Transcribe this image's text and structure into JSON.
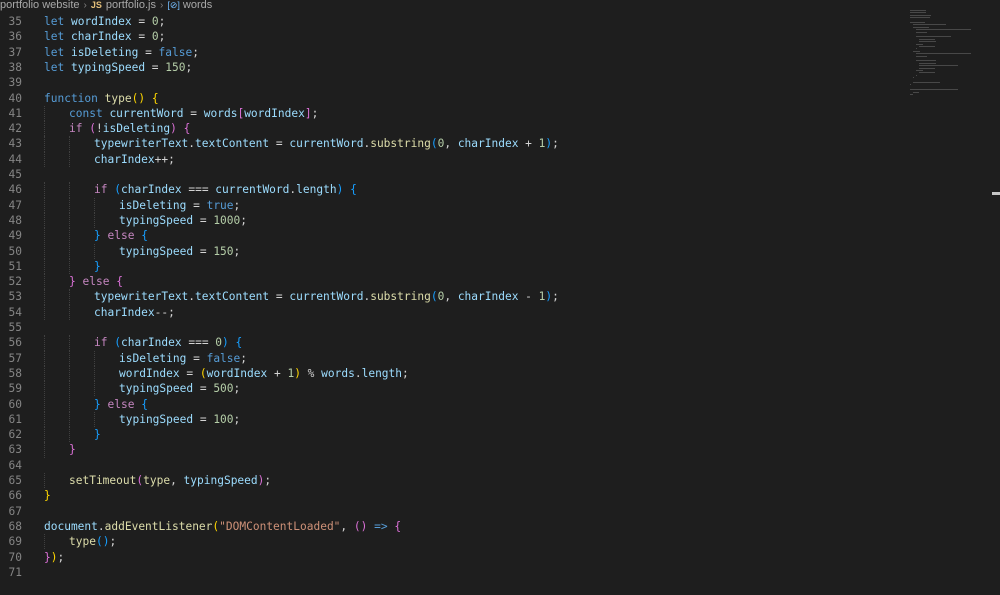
{
  "breadcrumb": {
    "folder": "portfolio website",
    "file_badge": "JS",
    "file": "portfolio.js",
    "symbol_badge": "[⊘]",
    "symbol": "words"
  },
  "colors": {
    "keyword": "#c586c0",
    "storage": "#569cd6",
    "variable": "#9cdcfe",
    "function": "#dcdcaa",
    "string": "#ce9178",
    "number": "#b5cea8",
    "plain": "#d4d4d4",
    "bracket1": "#ffd700",
    "bracket2": "#da70d6",
    "bracket3": "#179fff",
    "line_number": "#858585"
  },
  "lines": [
    {
      "n": "35",
      "indent": 0,
      "tokens": [
        [
          "storage",
          "let"
        ],
        [
          "plain",
          " "
        ],
        [
          "variable",
          "wordIndex"
        ],
        [
          "plain",
          " = "
        ],
        [
          "number",
          "0"
        ],
        [
          "plain",
          ";"
        ]
      ]
    },
    {
      "n": "36",
      "indent": 0,
      "tokens": [
        [
          "storage",
          "let"
        ],
        [
          "plain",
          " "
        ],
        [
          "variable",
          "charIndex"
        ],
        [
          "plain",
          " = "
        ],
        [
          "number",
          "0"
        ],
        [
          "plain",
          ";"
        ]
      ]
    },
    {
      "n": "37",
      "indent": 0,
      "tokens": [
        [
          "storage",
          "let"
        ],
        [
          "plain",
          " "
        ],
        [
          "variable",
          "isDeleting"
        ],
        [
          "plain",
          " = "
        ],
        [
          "storage",
          "false"
        ],
        [
          "plain",
          ";"
        ]
      ]
    },
    {
      "n": "38",
      "indent": 0,
      "tokens": [
        [
          "storage",
          "let"
        ],
        [
          "plain",
          " "
        ],
        [
          "variable",
          "typingSpeed"
        ],
        [
          "plain",
          " = "
        ],
        [
          "number",
          "150"
        ],
        [
          "plain",
          ";"
        ]
      ]
    },
    {
      "n": "39",
      "indent": 0,
      "tokens": []
    },
    {
      "n": "40",
      "indent": 0,
      "tokens": [
        [
          "storage",
          "function"
        ],
        [
          "plain",
          " "
        ],
        [
          "function",
          "type"
        ],
        [
          "bracket1",
          "()"
        ],
        [
          "plain",
          " "
        ],
        [
          "bracket1",
          "{"
        ]
      ]
    },
    {
      "n": "41",
      "indent": 1,
      "tokens": [
        [
          "storage",
          "const"
        ],
        [
          "plain",
          " "
        ],
        [
          "variable",
          "currentWord"
        ],
        [
          "plain",
          " = "
        ],
        [
          "variable",
          "words"
        ],
        [
          "bracket2",
          "["
        ],
        [
          "variable",
          "wordIndex"
        ],
        [
          "bracket2",
          "]"
        ],
        [
          "plain",
          ";"
        ]
      ]
    },
    {
      "n": "42",
      "indent": 1,
      "tokens": [
        [
          "keyword",
          "if"
        ],
        [
          "plain",
          " "
        ],
        [
          "bracket2",
          "("
        ],
        [
          "plain",
          "!"
        ],
        [
          "variable",
          "isDeleting"
        ],
        [
          "bracket2",
          ")"
        ],
        [
          "plain",
          " "
        ],
        [
          "bracket2",
          "{"
        ]
      ]
    },
    {
      "n": "43",
      "indent": 2,
      "tokens": [
        [
          "variable",
          "typewriterText"
        ],
        [
          "plain",
          "."
        ],
        [
          "variable",
          "textContent"
        ],
        [
          "plain",
          " = "
        ],
        [
          "variable",
          "currentWord"
        ],
        [
          "plain",
          "."
        ],
        [
          "function",
          "substring"
        ],
        [
          "bracket3",
          "("
        ],
        [
          "number",
          "0"
        ],
        [
          "plain",
          ", "
        ],
        [
          "variable",
          "charIndex"
        ],
        [
          "plain",
          " + "
        ],
        [
          "number",
          "1"
        ],
        [
          "bracket3",
          ")"
        ],
        [
          "plain",
          ";"
        ]
      ]
    },
    {
      "n": "44",
      "indent": 2,
      "tokens": [
        [
          "variable",
          "charIndex"
        ],
        [
          "plain",
          "++;"
        ]
      ]
    },
    {
      "n": "45",
      "indent": 0,
      "tokens": []
    },
    {
      "n": "46",
      "indent": 2,
      "tokens": [
        [
          "keyword",
          "if"
        ],
        [
          "plain",
          " "
        ],
        [
          "bracket3",
          "("
        ],
        [
          "variable",
          "charIndex"
        ],
        [
          "plain",
          " === "
        ],
        [
          "variable",
          "currentWord"
        ],
        [
          "plain",
          "."
        ],
        [
          "variable",
          "length"
        ],
        [
          "bracket3",
          ")"
        ],
        [
          "plain",
          " "
        ],
        [
          "bracket3",
          "{"
        ]
      ]
    },
    {
      "n": "47",
      "indent": 3,
      "tokens": [
        [
          "variable",
          "isDeleting"
        ],
        [
          "plain",
          " = "
        ],
        [
          "storage",
          "true"
        ],
        [
          "plain",
          ";"
        ]
      ]
    },
    {
      "n": "48",
      "indent": 3,
      "tokens": [
        [
          "variable",
          "typingSpeed"
        ],
        [
          "plain",
          " = "
        ],
        [
          "number",
          "1000"
        ],
        [
          "plain",
          ";"
        ]
      ]
    },
    {
      "n": "49",
      "indent": 2,
      "tokens": [
        [
          "bracket3",
          "}"
        ],
        [
          "plain",
          " "
        ],
        [
          "keyword",
          "else"
        ],
        [
          "plain",
          " "
        ],
        [
          "bracket3",
          "{"
        ]
      ]
    },
    {
      "n": "50",
      "indent": 3,
      "tokens": [
        [
          "variable",
          "typingSpeed"
        ],
        [
          "plain",
          " = "
        ],
        [
          "number",
          "150"
        ],
        [
          "plain",
          ";"
        ]
      ]
    },
    {
      "n": "51",
      "indent": 2,
      "tokens": [
        [
          "bracket3",
          "}"
        ]
      ]
    },
    {
      "n": "52",
      "indent": 1,
      "tokens": [
        [
          "bracket2",
          "}"
        ],
        [
          "plain",
          " "
        ],
        [
          "keyword",
          "else"
        ],
        [
          "plain",
          " "
        ],
        [
          "bracket2",
          "{"
        ]
      ]
    },
    {
      "n": "53",
      "indent": 2,
      "tokens": [
        [
          "variable",
          "typewriterText"
        ],
        [
          "plain",
          "."
        ],
        [
          "variable",
          "textContent"
        ],
        [
          "plain",
          " = "
        ],
        [
          "variable",
          "currentWord"
        ],
        [
          "plain",
          "."
        ],
        [
          "function",
          "substring"
        ],
        [
          "bracket3",
          "("
        ],
        [
          "number",
          "0"
        ],
        [
          "plain",
          ", "
        ],
        [
          "variable",
          "charIndex"
        ],
        [
          "plain",
          " - "
        ],
        [
          "number",
          "1"
        ],
        [
          "bracket3",
          ")"
        ],
        [
          "plain",
          ";"
        ]
      ]
    },
    {
      "n": "54",
      "indent": 2,
      "tokens": [
        [
          "variable",
          "charIndex"
        ],
        [
          "plain",
          "--;"
        ]
      ]
    },
    {
      "n": "55",
      "indent": 0,
      "tokens": []
    },
    {
      "n": "56",
      "indent": 2,
      "tokens": [
        [
          "keyword",
          "if"
        ],
        [
          "plain",
          " "
        ],
        [
          "bracket3",
          "("
        ],
        [
          "variable",
          "charIndex"
        ],
        [
          "plain",
          " === "
        ],
        [
          "number",
          "0"
        ],
        [
          "bracket3",
          ")"
        ],
        [
          "plain",
          " "
        ],
        [
          "bracket3",
          "{"
        ]
      ]
    },
    {
      "n": "57",
      "indent": 3,
      "tokens": [
        [
          "variable",
          "isDeleting"
        ],
        [
          "plain",
          " = "
        ],
        [
          "storage",
          "false"
        ],
        [
          "plain",
          ";"
        ]
      ]
    },
    {
      "n": "58",
      "indent": 3,
      "tokens": [
        [
          "variable",
          "wordIndex"
        ],
        [
          "plain",
          " = "
        ],
        [
          "bracket1",
          "("
        ],
        [
          "variable",
          "wordIndex"
        ],
        [
          "plain",
          " + "
        ],
        [
          "number",
          "1"
        ],
        [
          "bracket1",
          ")"
        ],
        [
          "plain",
          " % "
        ],
        [
          "variable",
          "words"
        ],
        [
          "plain",
          "."
        ],
        [
          "variable",
          "length"
        ],
        [
          "plain",
          ";"
        ]
      ]
    },
    {
      "n": "59",
      "indent": 3,
      "tokens": [
        [
          "variable",
          "typingSpeed"
        ],
        [
          "plain",
          " = "
        ],
        [
          "number",
          "500"
        ],
        [
          "plain",
          ";"
        ]
      ]
    },
    {
      "n": "60",
      "indent": 2,
      "tokens": [
        [
          "bracket3",
          "}"
        ],
        [
          "plain",
          " "
        ],
        [
          "keyword",
          "else"
        ],
        [
          "plain",
          " "
        ],
        [
          "bracket3",
          "{"
        ]
      ]
    },
    {
      "n": "61",
      "indent": 3,
      "tokens": [
        [
          "variable",
          "typingSpeed"
        ],
        [
          "plain",
          " = "
        ],
        [
          "number",
          "100"
        ],
        [
          "plain",
          ";"
        ]
      ]
    },
    {
      "n": "62",
      "indent": 2,
      "tokens": [
        [
          "bracket3",
          "}"
        ]
      ]
    },
    {
      "n": "63",
      "indent": 1,
      "tokens": [
        [
          "bracket2",
          "}"
        ]
      ]
    },
    {
      "n": "64",
      "indent": 0,
      "tokens": []
    },
    {
      "n": "65",
      "indent": 1,
      "tokens": [
        [
          "function",
          "setTimeout"
        ],
        [
          "bracket2",
          "("
        ],
        [
          "function",
          "type"
        ],
        [
          "plain",
          ", "
        ],
        [
          "variable",
          "typingSpeed"
        ],
        [
          "bracket2",
          ")"
        ],
        [
          "plain",
          ";"
        ]
      ]
    },
    {
      "n": "66",
      "indent": 0,
      "tokens": [
        [
          "bracket1",
          "}"
        ]
      ]
    },
    {
      "n": "67",
      "indent": 0,
      "tokens": []
    },
    {
      "n": "68",
      "indent": 0,
      "tokens": [
        [
          "variable",
          "document"
        ],
        [
          "plain",
          "."
        ],
        [
          "function",
          "addEventListener"
        ],
        [
          "bracket1",
          "("
        ],
        [
          "string",
          "\"DOMContentLoaded\""
        ],
        [
          "plain",
          ", "
        ],
        [
          "bracket2",
          "()"
        ],
        [
          "plain",
          " "
        ],
        [
          "storage",
          "=>"
        ],
        [
          "plain",
          " "
        ],
        [
          "bracket2",
          "{"
        ]
      ]
    },
    {
      "n": "69",
      "indent": 1,
      "tokens": [
        [
          "function",
          "type"
        ],
        [
          "bracket3",
          "()"
        ],
        [
          "plain",
          ";"
        ]
      ]
    },
    {
      "n": "70",
      "indent": 0,
      "tokens": [
        [
          "bracket2",
          "}"
        ],
        [
          "bracket1",
          ")"
        ],
        [
          "plain",
          ";"
        ]
      ]
    },
    {
      "n": "71",
      "indent": 0,
      "tokens": []
    }
  ]
}
